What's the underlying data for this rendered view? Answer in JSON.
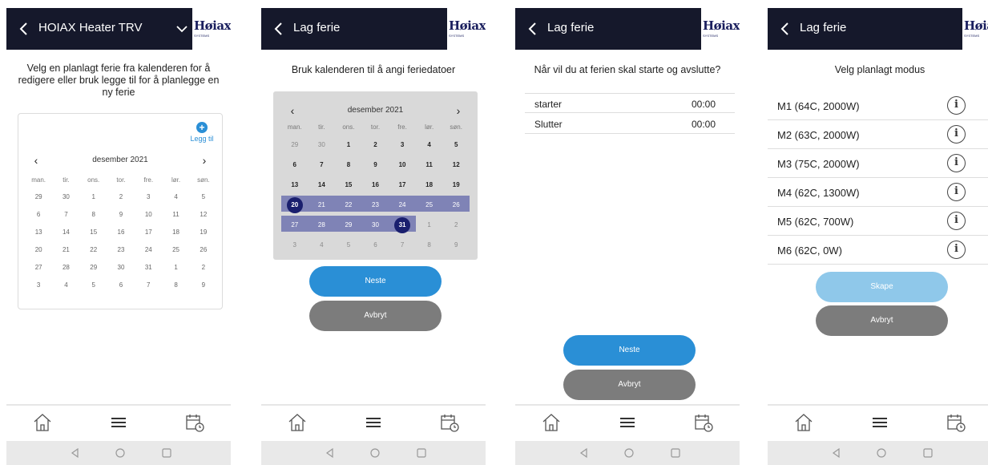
{
  "screen1": {
    "header_title": "HOIAX Heater TRV",
    "logo_text": "Høiax",
    "logo_sub": "SYSTEMS",
    "intro": "Velg en planlagt ferie fra kalenderen for å redigere eller bruk legge til for å planlegge en ny ferie",
    "add_label": "Legg til",
    "calendar": {
      "month": "desember 2021",
      "weekdays": [
        "man.",
        "tir.",
        "ons.",
        "tor.",
        "fre.",
        "lør.",
        "søn."
      ],
      "weeks": [
        [
          "29",
          "30",
          "1",
          "2",
          "3",
          "4",
          "5"
        ],
        [
          "6",
          "7",
          "8",
          "9",
          "10",
          "11",
          "12"
        ],
        [
          "13",
          "14",
          "15",
          "16",
          "17",
          "18",
          "19"
        ],
        [
          "20",
          "21",
          "22",
          "23",
          "24",
          "25",
          "26"
        ],
        [
          "27",
          "28",
          "29",
          "30",
          "31",
          "1",
          "2"
        ],
        [
          "3",
          "4",
          "5",
          "6",
          "7",
          "8",
          "9"
        ]
      ]
    }
  },
  "screen2": {
    "header_title": "Lag ferie",
    "logo_text": "Høiax",
    "logo_sub": "SYSTEMS",
    "intro": "Bruk kalenderen til å angi feriedatoer",
    "calendar": {
      "month": "desember 2021",
      "weekdays": [
        "man.",
        "tir.",
        "ons.",
        "tor.",
        "fre.",
        "lør.",
        "søn."
      ],
      "weeks": [
        [
          "29",
          "30",
          "1",
          "2",
          "3",
          "4",
          "5"
        ],
        [
          "6",
          "7",
          "8",
          "9",
          "10",
          "11",
          "12"
        ],
        [
          "13",
          "14",
          "15",
          "16",
          "17",
          "18",
          "19"
        ],
        [
          "20",
          "21",
          "22",
          "23",
          "24",
          "25",
          "26"
        ],
        [
          "27",
          "28",
          "29",
          "30",
          "31",
          "1",
          "2"
        ],
        [
          "3",
          "4",
          "5",
          "6",
          "7",
          "8",
          "9"
        ]
      ],
      "range_start": "20",
      "range_end": "31",
      "range_color": "#7f83b6",
      "endpoint_color": "#1a1f6e"
    },
    "next_label": "Neste",
    "cancel_label": "Avbryt"
  },
  "screen3": {
    "header_title": "Lag ferie",
    "logo_text": "Høiax",
    "logo_sub": "SYSTEMS",
    "intro": "Når vil du at ferien skal starte og avslutte?",
    "rows": [
      {
        "label": "starter",
        "value": "00:00"
      },
      {
        "label": "Slutter",
        "value": "00:00"
      }
    ],
    "next_label": "Neste",
    "cancel_label": "Avbryt"
  },
  "screen4": {
    "header_title": "Lag ferie",
    "logo_text": "Høiax",
    "logo_sub": "SYSTEMS",
    "intro": "Velg planlagt modus",
    "modes": [
      {
        "label": "M1 (64C, 2000W)"
      },
      {
        "label": "M2 (63C, 2000W)"
      },
      {
        "label": "M3 (75C, 2000W)"
      },
      {
        "label": "M4 (62C, 1300W)"
      },
      {
        "label": "M5 (62C, 700W)"
      },
      {
        "label": "M6 (62C, 0W)"
      }
    ],
    "info_glyph": "i",
    "create_label": "Skape",
    "cancel_label": "Avbryt"
  },
  "icons": {
    "back": "back-arrow-icon",
    "dropdown": "chevron-down-icon",
    "home": "home-icon",
    "menu": "menu-icon",
    "schedule": "calendar-clock-icon",
    "sys_back": "android-back-icon",
    "sys_home": "android-home-icon",
    "sys_recents": "android-recents-icon"
  },
  "colors": {
    "header_bg": "#15182b",
    "accent_blue": "#2a8fd6",
    "button_gray": "#7c7c7c",
    "button_disabled": "#8fc8ea"
  }
}
